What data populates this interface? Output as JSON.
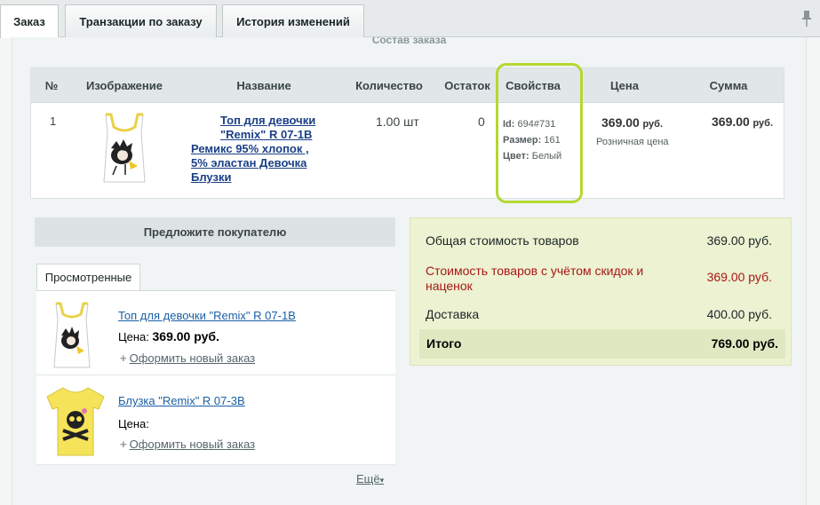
{
  "tabs": [
    {
      "label": "Заказ"
    },
    {
      "label": "Транзакции по заказу"
    },
    {
      "label": "История изменений"
    }
  ],
  "section_title_cut": "Состав заказа",
  "order_table": {
    "headers": [
      "№",
      "Изображение",
      "Название",
      "Количество",
      "Остаток",
      "Свойства",
      "Цена",
      "Сумма"
    ],
    "row": {
      "num": "1",
      "name_lines": [
        "Топ для девочки",
        "\"Remix\" R 07-1B",
        "Ремикс 95% хлопок ,",
        "5% эластан Девочка",
        "Блузки"
      ],
      "qty": "1.00 шт",
      "stock": "0",
      "props": [
        {
          "label": "Id:",
          "value": "694#731"
        },
        {
          "label": "Размер:",
          "value": "161"
        },
        {
          "label": "Цвет:",
          "value": "Белый"
        }
      ],
      "price": "369.00",
      "price_unit": "руб.",
      "price_type": "Розничная цена",
      "sum": "369.00",
      "sum_unit": "руб."
    }
  },
  "suggest": {
    "header": "Предложите покупателю",
    "tab": "Просмотренные",
    "items": [
      {
        "name": "Топ для девочки \"Remix\" R 07-1B",
        "price_label": "Цена:",
        "price": "369.00 руб.",
        "new_order": "Оформить новый заказ"
      },
      {
        "name": "Блузка \"Remix\" R 07-3B",
        "price_label": "Цена:",
        "price": "",
        "new_order": "Оформить новый заказ"
      }
    ],
    "more": "Ещё"
  },
  "totals": {
    "rows": [
      {
        "label": "Общая стоимость товаров",
        "value": "369.00 руб."
      },
      {
        "label_line1": "Стоимость товаров с учётом скидок и",
        "label_line2": "наценок",
        "value": "369.00 руб."
      },
      {
        "label": "Доставка",
        "value": "400.00 руб."
      }
    ],
    "final": {
      "label": "Итого",
      "value": "769.00 руб."
    }
  },
  "colors": {
    "accent_highlight": "#b3d831",
    "discount_red": "#a81616",
    "link_blue": "#1a3f86"
  }
}
